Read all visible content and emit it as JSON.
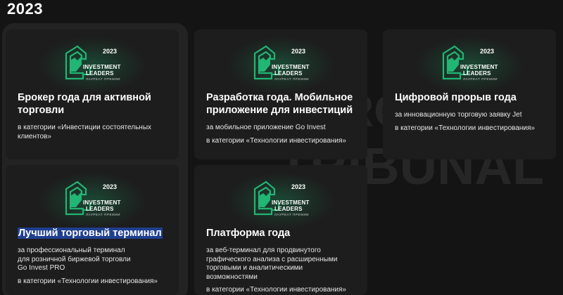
{
  "section": {
    "year": "2023"
  },
  "logo": {
    "year": "2023",
    "line1": "INVESTMENT",
    "line2": "LEADERS",
    "line3": "ЛАУРЕАТ ПРЕМИИ",
    "accent": "#22b573"
  },
  "watermark": {
    "text": "TRIBUNAL",
    "partial": "RO"
  },
  "cards": [
    {
      "title": "Брокер года для активной торговли",
      "title_lines": [
        "Брокер года для активной",
        "торговли"
      ],
      "desc_lines": [],
      "category": "в категории «Инвестиции состоятельных клиентов»",
      "category_lines": [
        "в категории «Инвестиции состоятельных",
        "клиентов»"
      ]
    },
    {
      "title": "Разработка года. Мобильное приложение для инвестиций",
      "title_lines": [
        "Разработка года. Мобильное",
        "приложение для инвестиций"
      ],
      "desc_lines": [
        "за мобильное приложение Go Invest"
      ],
      "category": "в категории «Технологии инвестирования»",
      "category_lines": [
        "в категории «Технологии инвестирования»"
      ]
    },
    {
      "title": "Цифровой прорыв года",
      "title_lines": [
        "Цифровой прорыв года"
      ],
      "desc_lines": [
        "за инновационную торговую заявку Jet"
      ],
      "category": "в категории «Технологии инвестирования»",
      "category_lines": [
        "в категории «Технологии инвестирования»"
      ]
    },
    {
      "title": "Лучший торговый терминал",
      "title_lines": [
        "Лучший торговый терминал"
      ],
      "desc_lines": [
        "за профессиональный терминал",
        "для розничной биржевой торговли",
        "Go Invest PRO"
      ],
      "category": "в категории «Технологии инвестирования»",
      "category_lines": [
        "в категории «Технологии инвестирования»"
      ]
    },
    {
      "title": "Платформа года",
      "title_lines": [
        "Платформа года"
      ],
      "desc_lines": [
        "за веб-терминал для продвинутого",
        "графического анализа с расширенными",
        "торговыми и аналитическими",
        "возможностями"
      ],
      "category": "в категории «Технологии инвестирования»",
      "category_lines": [
        "в категории «Технологии инвестирования»"
      ]
    }
  ]
}
